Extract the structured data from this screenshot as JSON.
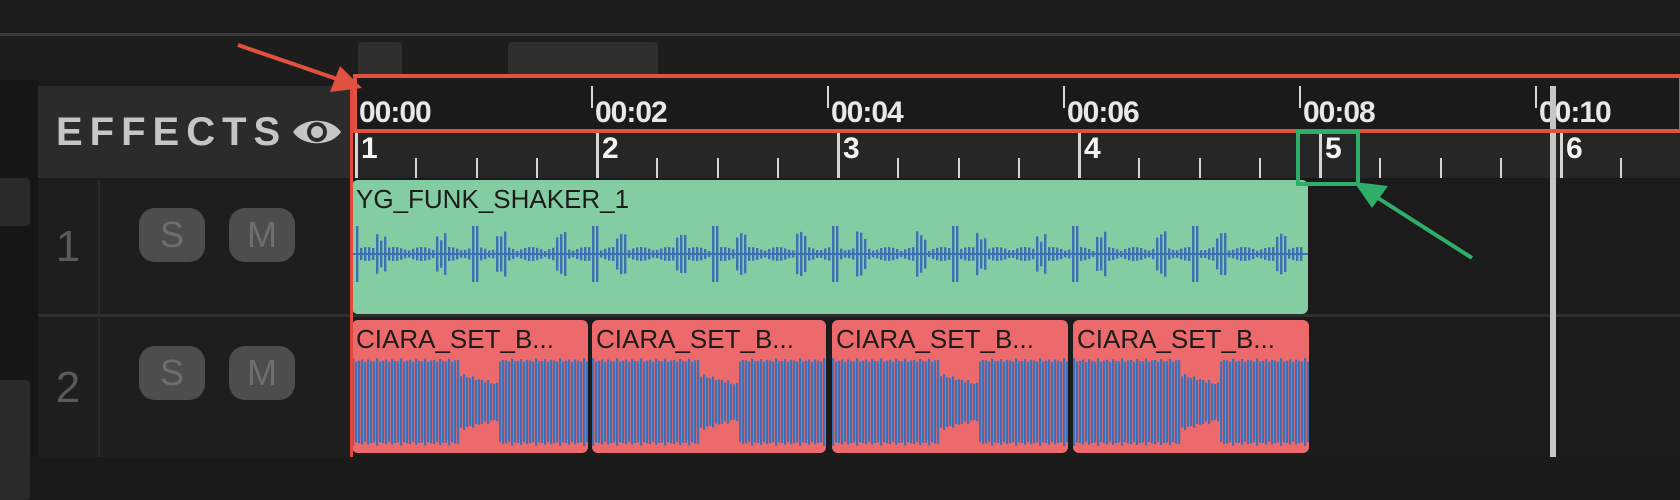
{
  "effects": {
    "label": "EFFECTS",
    "icon": "eye-icon"
  },
  "timeline": {
    "time_marks": [
      "00:00",
      "00:02",
      "00:04",
      "00:06",
      "00:08",
      "00:10"
    ],
    "bar_marks": [
      "1",
      "2",
      "3",
      "4",
      "5",
      "6"
    ]
  },
  "tracks": [
    {
      "number": "1",
      "solo_label": "S",
      "mute_label": "M",
      "clips": [
        {
          "name": "YG_FUNK_SHAKER_1"
        }
      ]
    },
    {
      "number": "2",
      "solo_label": "S",
      "mute_label": "M",
      "clips": [
        {
          "name": "CIARA_SET_B..."
        },
        {
          "name": "CIARA_SET_B..."
        },
        {
          "name": "CIARA_SET_B..."
        },
        {
          "name": "CIARA_SET_B..."
        }
      ]
    }
  ],
  "colors": {
    "playhead": "#e3483f",
    "track1_clip": "#84cda3",
    "track2_clip": "#ec6a6b",
    "waveform": "#3f6fb5",
    "annotation_red": "#e0523f",
    "annotation_green": "#2fae6a"
  }
}
